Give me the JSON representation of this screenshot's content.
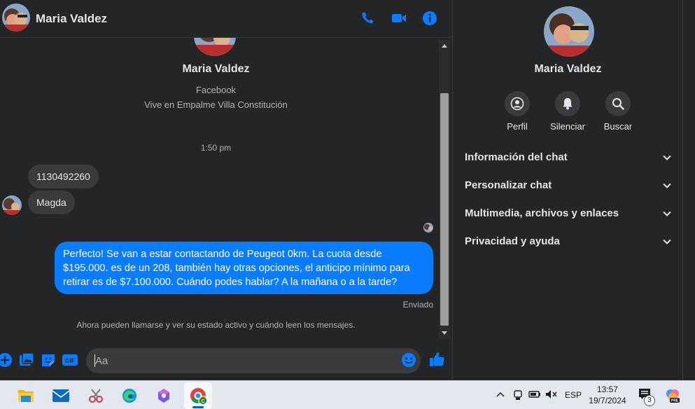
{
  "header": {
    "contact_name": "Maria Valdez"
  },
  "profile": {
    "name": "Maria Valdez",
    "source": "Facebook",
    "location": "Vive en Empalme Villa Constitución"
  },
  "conversation": {
    "time_separator": "1:50 pm",
    "incoming": [
      "1130492260",
      "Magda"
    ],
    "outgoing": {
      "text": "Perfecto!  Se van a estar contactando de Peugeot 0km. La cuota desde $195.000. es de un 208, también hay otras opciones, el anticipo mínimo para retirar es de $7.100.000. Cuándo podes hablar? A la mañana o a la tarde?",
      "status": "Enviado"
    },
    "info_note": "Ahora pueden llamarse y ver su estado activo y cuándo leen los mensajes."
  },
  "composer": {
    "placeholder": "Aa",
    "gif_label": "GIF"
  },
  "right_panel": {
    "name": "Maria Valdez",
    "actions": [
      {
        "label": "Perfil",
        "icon": "profile-icon"
      },
      {
        "label": "Silenciar",
        "icon": "bell-icon"
      },
      {
        "label": "Buscar",
        "icon": "search-icon"
      }
    ],
    "sections": [
      "Información del chat",
      "Personalizar chat",
      "Multimedia, archivos y enlaces",
      "Privacidad y ayuda"
    ]
  },
  "taskbar": {
    "language": "ESP",
    "time": "13:57",
    "date": "19/7/2024",
    "notification_count": "3"
  },
  "colors": {
    "accent": "#0a7cff",
    "background": "#242526",
    "bubble_incoming": "#3a3b3c",
    "taskbar": "#e3e8f0"
  }
}
